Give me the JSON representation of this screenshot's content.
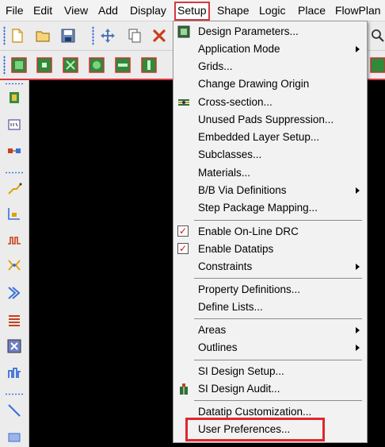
{
  "menubar": {
    "items": [
      "File",
      "Edit",
      "View",
      "Add",
      "Display",
      "Setup",
      "Shape",
      "Logic",
      "Place",
      "FlowPlan"
    ],
    "active": "Setup"
  },
  "setup_menu": {
    "items": [
      {
        "label": "Design Parameters...",
        "icon": "design-parameters-icon"
      },
      {
        "label": "Application Mode",
        "submenu": true
      },
      {
        "label": "Grids..."
      },
      {
        "label": "Change Drawing Origin"
      },
      {
        "label": "Cross-section...",
        "icon": "cross-section-icon"
      },
      {
        "label": "Unused Pads Suppression..."
      },
      {
        "label": "Embedded Layer Setup..."
      },
      {
        "label": "Subclasses..."
      },
      {
        "label": "Materials..."
      },
      {
        "label": "B/B Via Definitions",
        "submenu": true
      },
      {
        "label": "Step Package Mapping..."
      },
      {
        "label": "Enable On-Line DRC",
        "checked": true
      },
      {
        "label": "Enable Datatips",
        "checked": true
      },
      {
        "label": "Constraints",
        "submenu": true
      },
      {
        "label": "Property Definitions..."
      },
      {
        "label": "Define Lists..."
      },
      {
        "label": "Areas",
        "submenu": true
      },
      {
        "label": "Outlines",
        "submenu": true
      },
      {
        "label": "SI Design Setup..."
      },
      {
        "label": "SI Design Audit...",
        "icon": "si-audit-icon"
      },
      {
        "label": "Datatip Customization..."
      },
      {
        "label": "User Preferences...",
        "highlighted": true
      }
    ]
  },
  "check_mark": "✓",
  "colors": {
    "highlight_border": "#e0262d",
    "canvas": "#000000",
    "check_mark": "#d01010"
  }
}
